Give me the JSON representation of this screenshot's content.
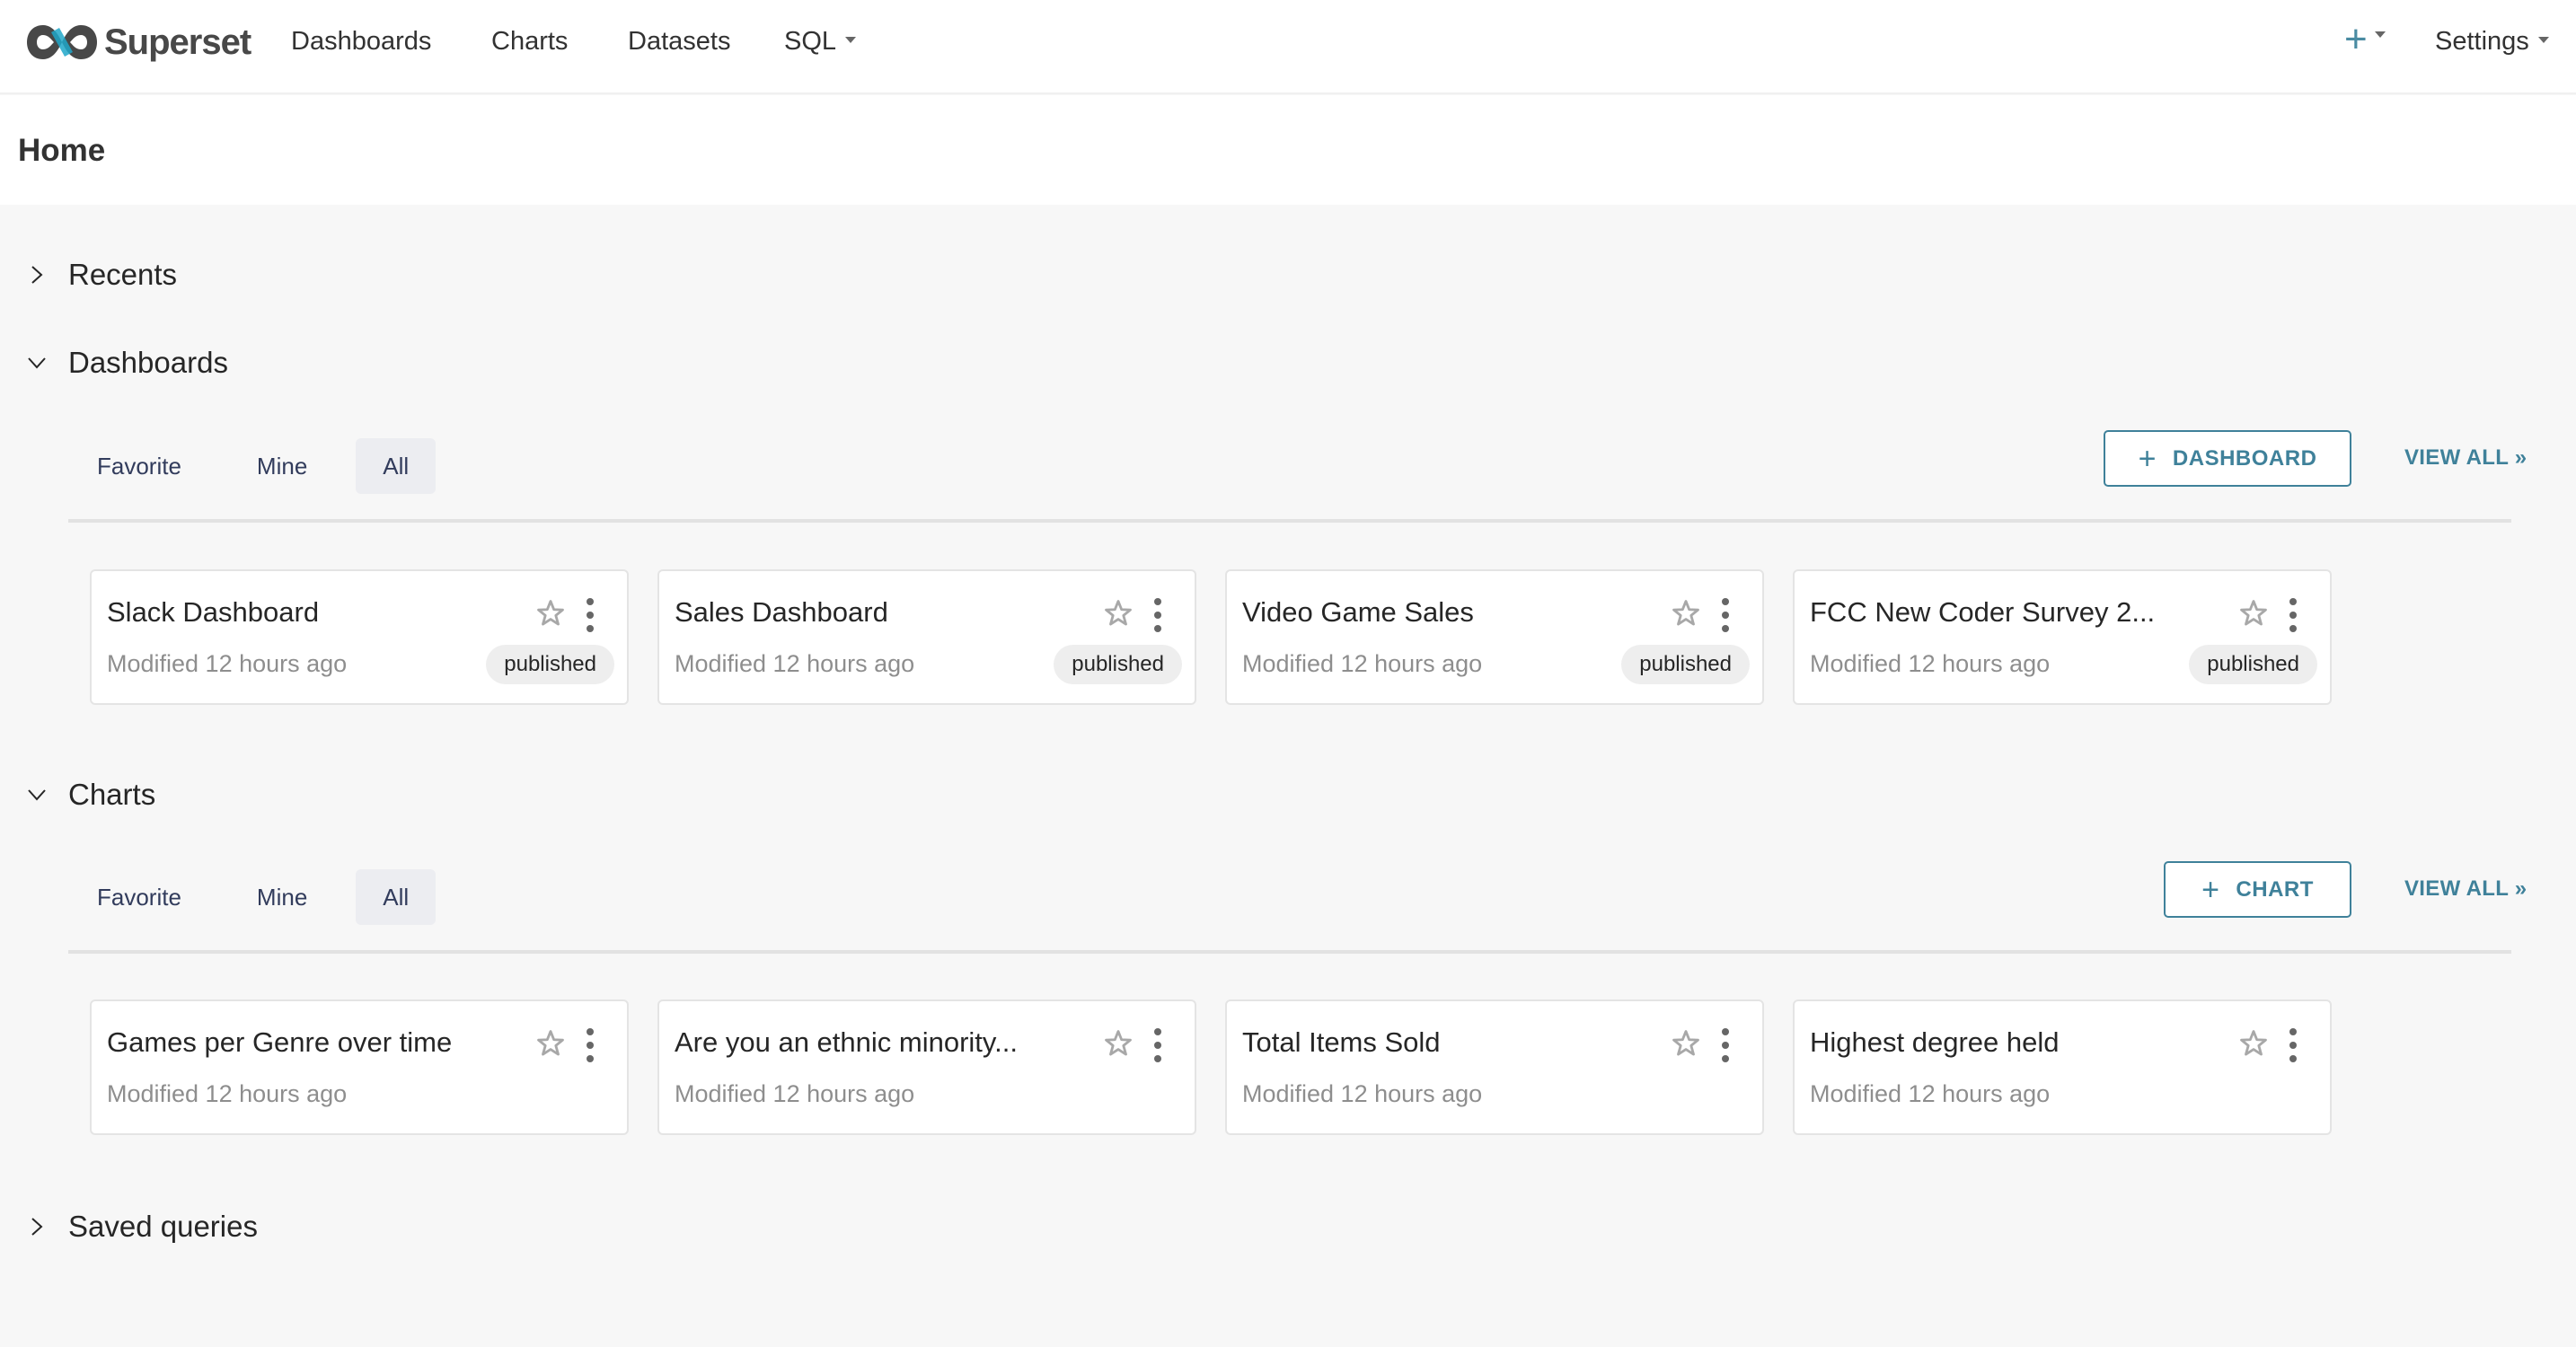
{
  "navbar": {
    "brand": "Superset",
    "items": [
      {
        "label": "Dashboards"
      },
      {
        "label": "Charts"
      },
      {
        "label": "Datasets"
      },
      {
        "label": "SQL",
        "has_dropdown": true
      }
    ],
    "plus_icon": "plus-icon",
    "settings_label": "Settings"
  },
  "colors": {
    "accent": "#3f819a",
    "logo_dark": "#484848",
    "logo_blue": "#20a7c9"
  },
  "page": {
    "title": "Home"
  },
  "sections": {
    "recents": {
      "label": "Recents",
      "expanded": false
    },
    "dashboards": {
      "label": "Dashboards",
      "expanded": true,
      "tabs": [
        "Favorite",
        "Mine",
        "All"
      ],
      "active_tab": "All",
      "add_button": "DASHBOARD",
      "view_all": "VIEW ALL »",
      "cards": [
        {
          "title": "Slack Dashboard",
          "modified": "Modified 12 hours ago",
          "status": "published"
        },
        {
          "title": "Sales Dashboard",
          "modified": "Modified 12 hours ago",
          "status": "published"
        },
        {
          "title": "Video Game Sales",
          "modified": "Modified 12 hours ago",
          "status": "published"
        },
        {
          "title": "FCC New Coder Survey 2...",
          "modified": "Modified 12 hours ago",
          "status": "published"
        }
      ]
    },
    "charts": {
      "label": "Charts",
      "expanded": true,
      "tabs": [
        "Favorite",
        "Mine",
        "All"
      ],
      "active_tab": "All",
      "add_button": "CHART",
      "view_all": "VIEW ALL »",
      "cards": [
        {
          "title": "Games per Genre over time",
          "modified": "Modified 12 hours ago"
        },
        {
          "title": "Are you an ethnic minority...",
          "modified": "Modified 12 hours ago"
        },
        {
          "title": "Total Items Sold",
          "modified": "Modified 12 hours ago"
        },
        {
          "title": "Highest degree held",
          "modified": "Modified 12 hours ago"
        }
      ]
    },
    "saved_queries": {
      "label": "Saved queries",
      "expanded": false
    }
  }
}
